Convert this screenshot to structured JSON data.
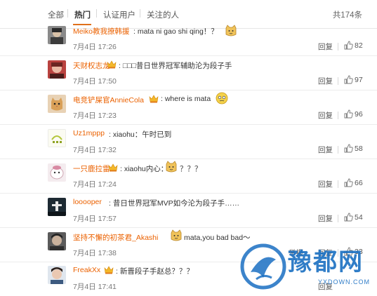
{
  "tabs": {
    "all": "全部",
    "hot": "热门",
    "verified": "认证用户",
    "following": "关注的人"
  },
  "total": "共174条",
  "reply_label": "回复",
  "report_label": "举报",
  "comments": [
    {
      "name": "Meiko教我撩韩援",
      "text": ": mata ni gao shi qing！？",
      "date": "7月4日 17:26",
      "likes": "82"
    },
    {
      "name": "天财权志龙",
      "text": ": □□□昔日世界冠军辅助沦为段子手",
      "date": "7月4日 17:50",
      "likes": "97"
    },
    {
      "name": "电竞铲屎官AnnieCola",
      "text": ": where is mata",
      "date": "7月4日 17:23",
      "likes": "96"
    },
    {
      "name": "Uz1mppp",
      "text": ": xiaohu：午时已到",
      "date": "7月4日 17:32",
      "likes": "58"
    },
    {
      "name": "一只鹿拉雷",
      "text": ": xiaohu内心：",
      "text2": "？？？",
      "date": "7月4日 17:24",
      "likes": "66"
    },
    {
      "name": "looooper",
      "text": ": 昔日世界冠军MVP如今沦为段子手……",
      "date": "7月4日 17:57",
      "likes": "54"
    },
    {
      "name": "坚持不懈的初茶君_Akashi",
      "text": "mata,you bad bad～",
      "date": "7月4日 17:38",
      "likes": "33"
    },
    {
      "name": "FreakXx",
      "text": ": 新晋段子手赵总？？？",
      "date": "7月4日 17:41",
      "likes": ""
    }
  ],
  "watermark": {
    "title": "豫都网",
    "sub": "YXDOWN.COM"
  },
  "colors": {
    "accent": "#eb6100",
    "underline": "#e0701a",
    "watermark": "#1a6fc2"
  }
}
